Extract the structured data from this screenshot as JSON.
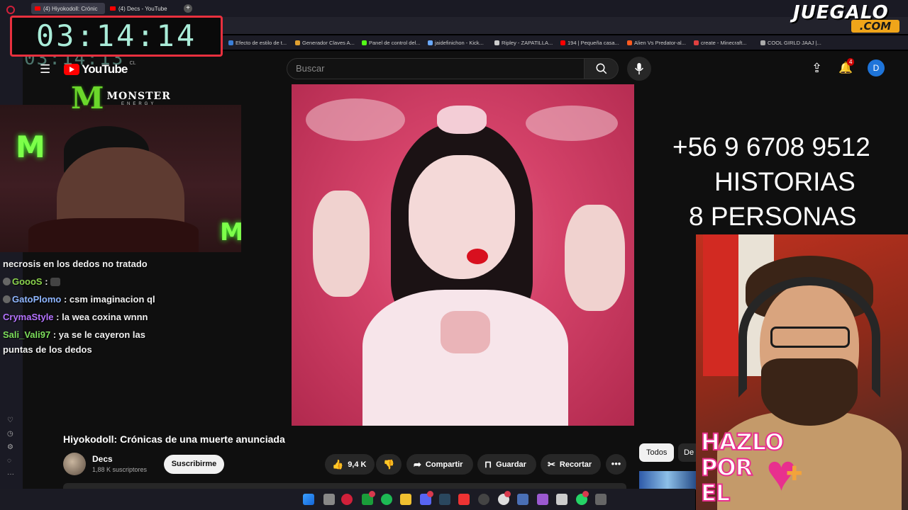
{
  "browser": {
    "tabs": [
      {
        "label": "(4) Hiyokodoll: Crónic"
      },
      {
        "label": "(4) Decs - YouTube"
      }
    ],
    "new_tab": "+",
    "bookmarks": [
      {
        "label": "Efecto de estilo de t...",
        "color": "#3b7fd8"
      },
      {
        "label": "Generador Claves A...",
        "color": "#e0a030"
      },
      {
        "label": "Panel de control del...",
        "color": "#53fc18"
      },
      {
        "label": "jaidefinichon - Kick...",
        "color": "#6aa9ff"
      },
      {
        "label": "Ripley - ZAPATILLA...",
        "color": "#cccccc"
      },
      {
        "label": "194 | Pequeña casa...",
        "color": "#ff0000"
      },
      {
        "label": "Alien Vs Predator-al...",
        "color": "#ff5a1f"
      },
      {
        "label": "create - Minecraft...",
        "color": "#e04040"
      },
      {
        "label": "COOL GIRLD JAAJ |...",
        "color": "#aaaaaa"
      }
    ]
  },
  "youtube": {
    "logo": "YouTube",
    "country": "CL",
    "search_placeholder": "Buscar",
    "notifications": "4",
    "avatar_letter": "D",
    "video_title": "Hiyokodoll: Crónicas de una muerte anunciada",
    "channel": {
      "name": "Decs",
      "subscribers": "1,88 K suscriptores"
    },
    "subscribe": "Suscribirme",
    "likes": "9,4 K",
    "share": "Compartir",
    "save": "Guardar",
    "clip": "Recortar",
    "more": "•••",
    "chips": [
      "Todos",
      "De"
    ]
  },
  "overlay": {
    "timer": "03:14:14",
    "timer_ghost": "03:14:13",
    "monster_brand": "MONSTER",
    "monster_sub": "ENERGY",
    "phone": "+56 9 6708 9512",
    "line2": "HISTORIAS",
    "line3": "8 PERSONAS",
    "hazlo": [
      "HAZLO",
      "POR",
      "EL"
    ],
    "juegalo": "JUEGALO",
    "juegalo_com": ".COM"
  },
  "chat": {
    "partial": "necrosis en los dedos no tratado",
    "messages": [
      {
        "user": "GoooS",
        "text": "",
        "color": "#8bd34d"
      },
      {
        "user": "GatoPlomo",
        "text": "csm imaginacion ql",
        "color": "#8fb6ff"
      },
      {
        "user": "CrymaStyle",
        "text": "la wea coxina wnnn",
        "color": "#b573ff"
      },
      {
        "user": "Sali_Vali97",
        "text": "ya se le cayeron las",
        "color": "#7ddf5c"
      }
    ],
    "continuation": "puntas de los dedos"
  },
  "colors": {
    "yt_red": "#ff0000",
    "timer_border": "#e8303e",
    "timer_text": "#a9ecd8",
    "hazlo_pink": "#e8308e",
    "juegalo_orange": "#f0a51a"
  }
}
